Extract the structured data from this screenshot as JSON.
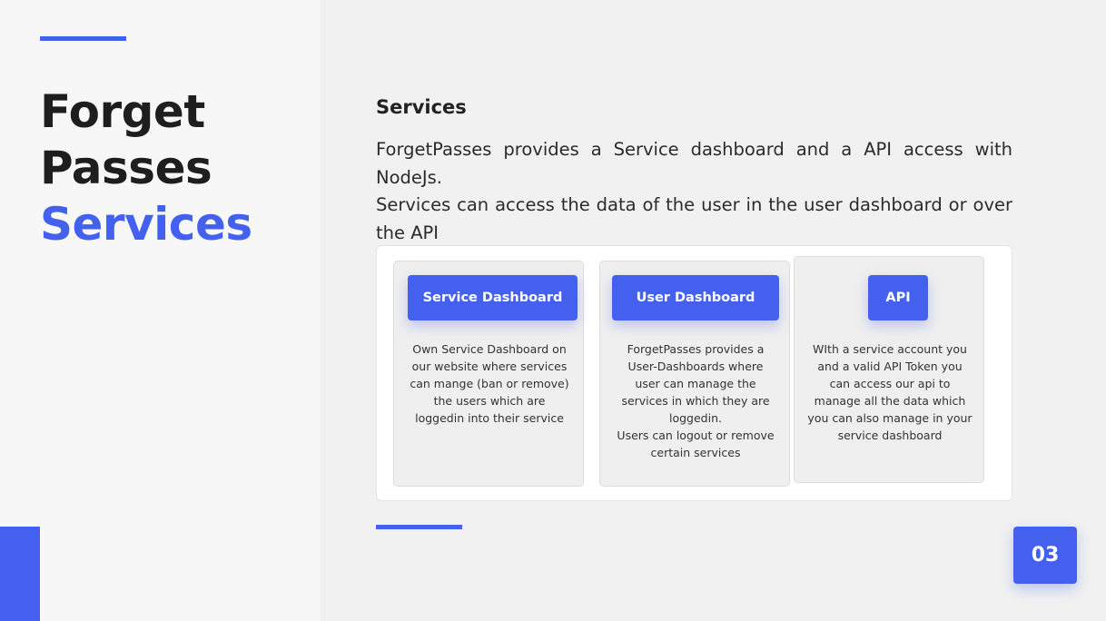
{
  "title": {
    "line1": "Forget",
    "line2": "Passes",
    "line3": "Services"
  },
  "section": {
    "heading": "Services",
    "paragraph1": "ForgetPasses provides a Service dashboard and a API access with NodeJs.",
    "paragraph2": "Services can access the data of the user in the user dashboard or over the API"
  },
  "cards": [
    {
      "button_label": "Service Dashboard",
      "text": "Own Service Dashboard on\nour website where services\ncan mange (ban or remove)\nthe users which are\nloggedin into their service"
    },
    {
      "button_label": "User Dashboard",
      "text": "ForgetPasses provides a\nUser-Dashboards where\nuser can manage the\nservices in which they are\nloggedin.\nUsers can logout or remove\ncertain services"
    },
    {
      "button_label": "API",
      "text": "WIth a service account you\nand a valid API Token you\ncan access our api to\nmanage all the data which\nyou can also manage in your\nservice dashboard"
    }
  ],
  "page_number": "03",
  "colors": {
    "accent": "#4361ee",
    "left_panel_bg": "#f7f7f7",
    "main_bg": "#f1f1f1"
  }
}
